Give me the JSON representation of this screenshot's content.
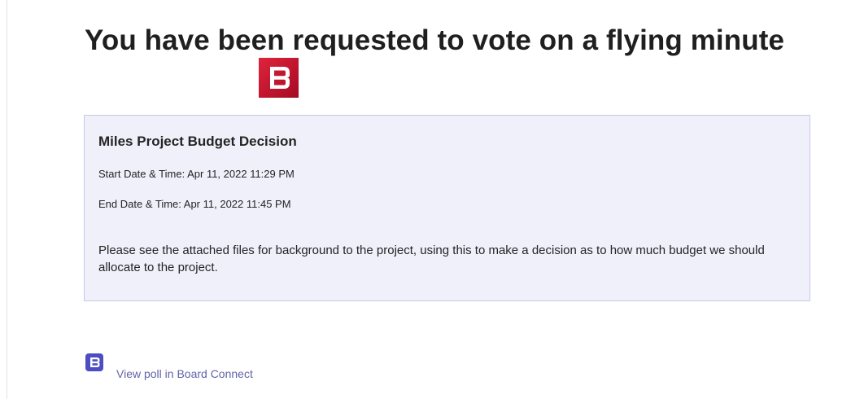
{
  "header": {
    "title": "You have been requested to vote on a flying minute",
    "logo_icon": "board-connect-logo-icon",
    "logo_color": "#c8102e"
  },
  "poll_card": {
    "title": "Miles Project Budget Decision",
    "start": "Start Date & Time: Apr 11, 2022 11:29 PM",
    "end": "End Date & Time: Apr 11, 2022 11:45 PM",
    "description": "Please see the attached files for background to the project, using this to make a decision as to how much budget we should allocate to the project."
  },
  "footer": {
    "link_label": "View poll in Board Connect",
    "icon": "board-connect-icon",
    "link_color": "#6264a7"
  }
}
